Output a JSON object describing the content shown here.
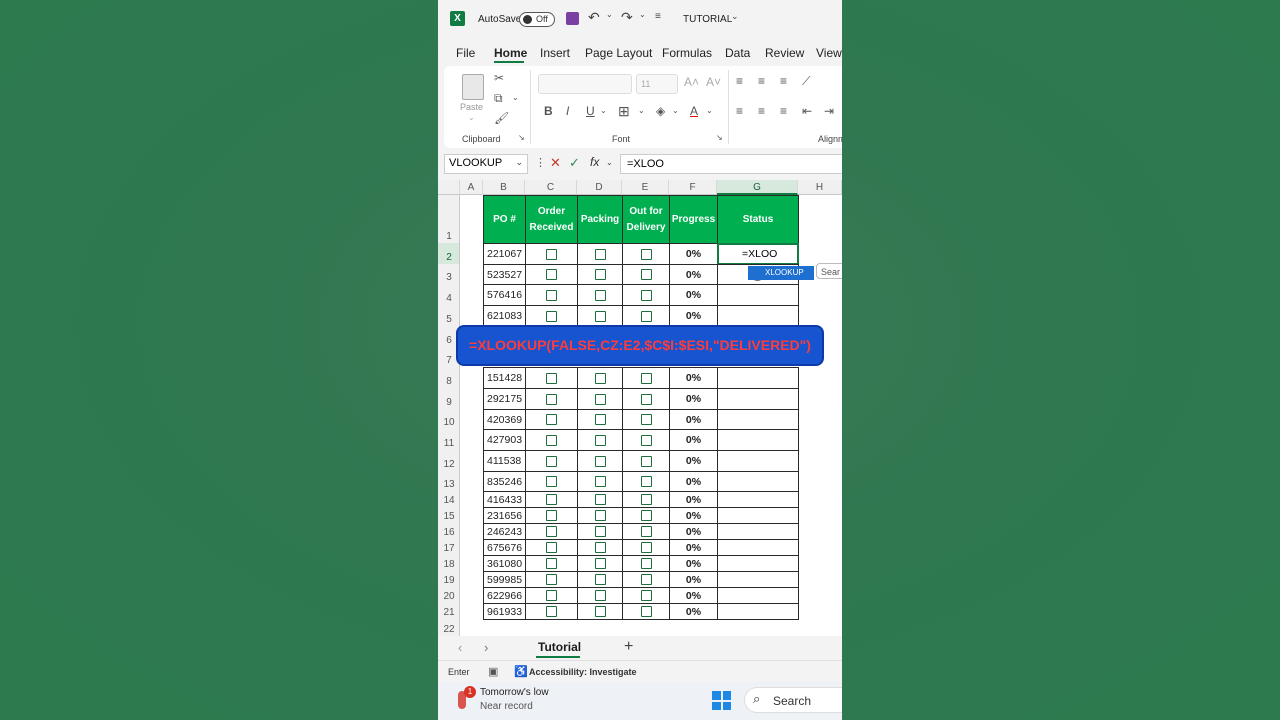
{
  "titlebar": {
    "autosave_label": "AutoSave",
    "autosave_state": "Off",
    "doc_title": "TUTORIAL"
  },
  "menu": [
    "File",
    "Home",
    "Insert",
    "Page Layout",
    "Formulas",
    "Data",
    "Review",
    "View"
  ],
  "active_menu": "Home",
  "ribbon": {
    "paste_label": "Paste",
    "clipboard_label": "Clipboard",
    "font_group_label": "Font",
    "font_size_placeholder": "11",
    "alignment_label": "Alignm",
    "bold": "B",
    "italic": "I",
    "underline": "U"
  },
  "formula_bar": {
    "name_box": "VLOOKUP",
    "fx": "fx",
    "value": "=XLOO"
  },
  "columns": [
    "A",
    "B",
    "C",
    "D",
    "E",
    "F",
    "G",
    "H"
  ],
  "row_numbers": [
    "1",
    "2",
    "3",
    "4",
    "5",
    "6",
    "7",
    "8",
    "9",
    "10",
    "11",
    "12",
    "13",
    "14",
    "15",
    "16",
    "17",
    "18",
    "19",
    "20",
    "21",
    "22"
  ],
  "table": {
    "headers": [
      "PO #",
      "Order Received",
      "Packing",
      "Out for Delivery",
      "Progress",
      "Status"
    ],
    "rows": [
      {
        "row": "2",
        "po": "221067",
        "progress": "0%"
      },
      {
        "row": "3",
        "po": "523527",
        "progress": "0%"
      },
      {
        "row": "4",
        "po": "576416",
        "progress": "0%"
      },
      {
        "row": "5",
        "po": "621083",
        "progress": "0%"
      },
      {
        "row": "8",
        "po": "151428",
        "progress": "0%"
      },
      {
        "row": "9",
        "po": "292175",
        "progress": "0%"
      },
      {
        "row": "10",
        "po": "420369",
        "progress": "0%"
      },
      {
        "row": "11",
        "po": "427903",
        "progress": "0%"
      },
      {
        "row": "12",
        "po": "411538",
        "progress": "0%"
      },
      {
        "row": "13",
        "po": "835246",
        "progress": "0%"
      },
      {
        "row": "14",
        "po": "416433",
        "progress": "0%"
      },
      {
        "row": "15",
        "po": "231656",
        "progress": "0%"
      },
      {
        "row": "16",
        "po": "246243",
        "progress": "0%"
      },
      {
        "row": "17",
        "po": "675676",
        "progress": "0%"
      },
      {
        "row": "18",
        "po": "361080",
        "progress": "0%"
      },
      {
        "row": "19",
        "po": "599985",
        "progress": "0%"
      },
      {
        "row": "20",
        "po": "622966",
        "progress": "0%"
      },
      {
        "row": "21",
        "po": "961933",
        "progress": "0%"
      }
    ],
    "active_cell_text": "=XLOO"
  },
  "autocomplete": {
    "item": "XLOOKUP",
    "search_hint": "Sear"
  },
  "overlay_banner": "=XLOOKUP(FALSE,CZ:E2,$C$I:$ESI,\"DELIVERED\")",
  "sheet_tab": "Tutorial",
  "add_sheet": "+",
  "status_bar": {
    "mode": "Enter",
    "accessibility": "Accessibility: Investigate"
  },
  "taskbar": {
    "weather_title": "Tomorrow's low",
    "weather_sub": "Near record",
    "badge": "1",
    "search": "Search"
  },
  "colors": {
    "accent": "#107c41",
    "header_green": "#00b050",
    "banner_blue": "#1655cf",
    "banner_text": "#ff3b3b"
  }
}
